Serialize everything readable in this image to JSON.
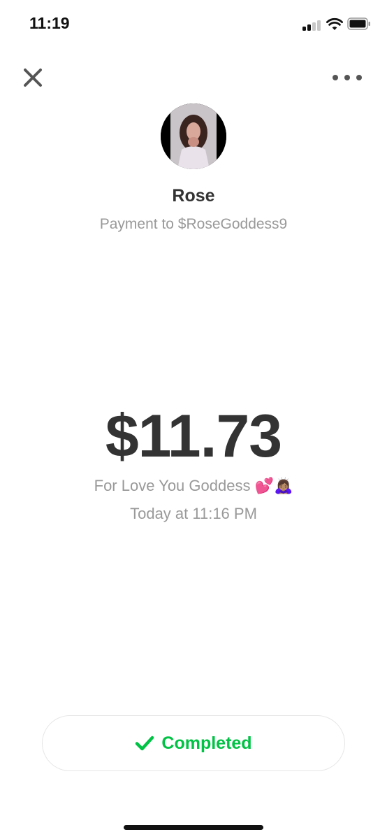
{
  "status_bar": {
    "time": "11:19"
  },
  "header": {
    "close_icon": "close-icon",
    "more_icon": "more-horizontal-icon"
  },
  "recipient": {
    "name": "Rose",
    "subtitle": "Payment to $RoseGoddess9"
  },
  "payment": {
    "amount": "$11.73",
    "note": "For Love You Goddess 💕🙇🏽‍♀️",
    "timestamp": "Today at 11:16 PM"
  },
  "status": {
    "label": "Completed",
    "color": "#00c244",
    "icon": "checkmark-icon"
  },
  "colors": {
    "primary_text": "#333333",
    "secondary_text": "#999999",
    "success": "#00c244"
  }
}
